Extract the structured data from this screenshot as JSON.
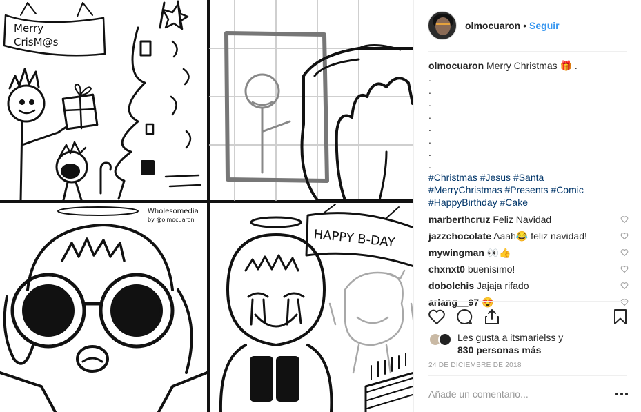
{
  "post": {
    "author": "olmocuaron",
    "follow_label": "Seguir",
    "separator": "•",
    "artwork": {
      "banner_text": "Merry\nCrisM@s",
      "signature": "Wholesomedia\nby @olmocuaron",
      "birthday_banner": "HAPPY B-DAY"
    },
    "caption": {
      "username": "olmocuaron",
      "text": "Merry Christmas 🎁 .",
      "dots": [
        ".",
        ".",
        ".",
        ".",
        ".",
        ".",
        ".",
        "."
      ],
      "hashtags": [
        "#Christmas",
        "#Jesus",
        "#Santa",
        "#MerryChristmas",
        "#Presents",
        "#Comic",
        "#HappyBirthday",
        "#Cake"
      ]
    },
    "comments": [
      {
        "username": "marberthcruz",
        "text": "Feliz Navidad"
      },
      {
        "username": "jazzchocolate",
        "text": "Aaah😂 feliz navidad!"
      },
      {
        "username": "mywingman",
        "text": "👀👍"
      },
      {
        "username": "chxnxt0",
        "text": "buenísimo!"
      },
      {
        "username": "dobolchis",
        "text": "Jajaja rifado"
      },
      {
        "username": "ariang__97",
        "text": "😍"
      }
    ],
    "likes": {
      "line1": "Les gusta a itsmarielss y",
      "line2": "830 personas más"
    },
    "date": "24 DE DICIEMBRE DE 2018",
    "add_comment_placeholder": "Añade un comentario..."
  }
}
